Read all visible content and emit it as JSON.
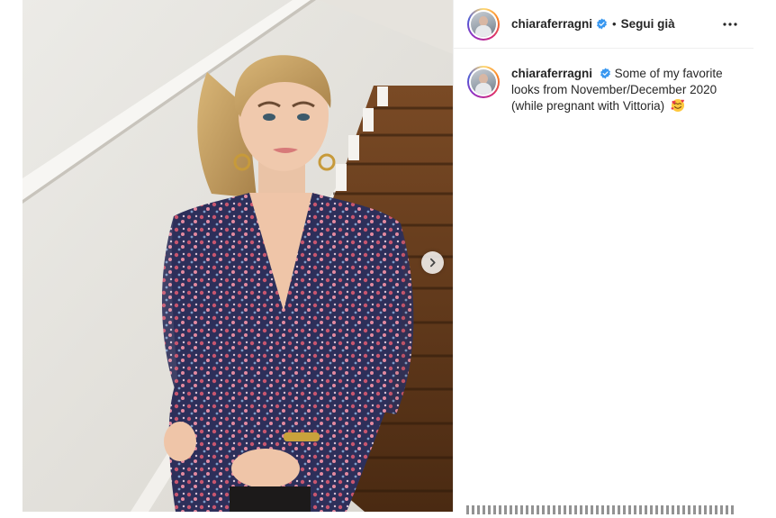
{
  "post": {
    "username": "chiaraferragni",
    "follow_state": "Segui già",
    "separator": "•",
    "verified_icon": "verified-badge-icon",
    "more_icon": "more-options-icon",
    "caption": {
      "username": "chiaraferragni",
      "text": "Some of my favorite looks from November/December 2020 (while pregnant with Vittoria)",
      "emoji": "smiling-face-with-hearts-icon"
    },
    "media": {
      "next_icon": "chevron-right-icon"
    }
  },
  "colors": {
    "verified_blue": "#3897f0",
    "text": "#262626",
    "border": "#efefef"
  }
}
